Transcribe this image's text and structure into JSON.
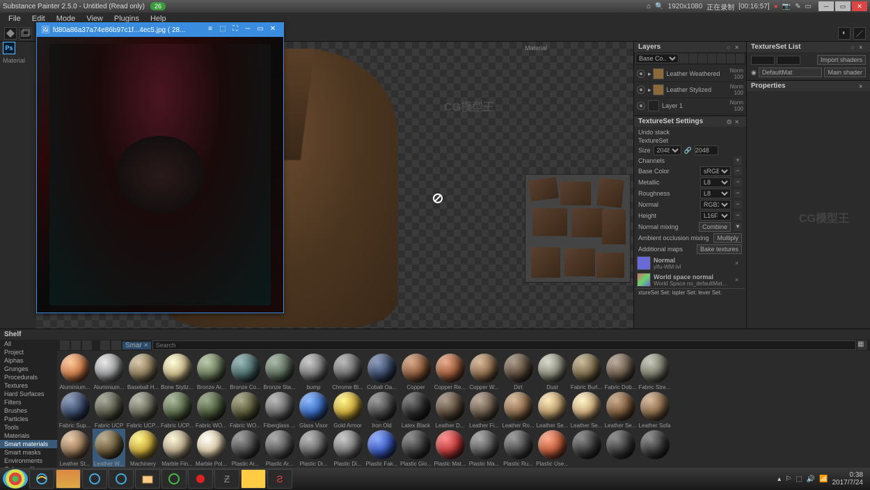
{
  "app": {
    "title": "Substance Painter 2.5.0 - Untitled (Read only)"
  },
  "recording": {
    "resolution": "1920x1080",
    "status": "正在录制",
    "time": "[00:16:57]"
  },
  "badge": "26",
  "menu": [
    "File",
    "Edit",
    "Mode",
    "View",
    "Plugins",
    "Help"
  ],
  "left_rail": {
    "label": "Material"
  },
  "imgwin": {
    "icon": "🖼",
    "title": "fd80a86a37a74e86b97c1f...4ec5.jpg ( 28..."
  },
  "viewport2d": {
    "label": "Material"
  },
  "panels": {
    "layers": {
      "title": "Layers",
      "channel": "Base Co..",
      "items": [
        {
          "name": "Leather Weathered",
          "mode": "Norm",
          "op": "100"
        },
        {
          "name": "Leather Stylized",
          "mode": "Norm",
          "op": "100"
        },
        {
          "name": "Layer 1",
          "mode": "Norm",
          "op": "100"
        }
      ]
    },
    "texset_list": {
      "title": "TextureSet List",
      "import": "Import shaders",
      "default": "DefaultMat",
      "main": "Main shader"
    },
    "properties": {
      "title": "Properties"
    },
    "texset": {
      "title": "TextureSet Settings",
      "undo": "Undo stack",
      "texset_label": "TextureSet",
      "size_label": "Size",
      "size": "2048",
      "size2": "2048",
      "channels": "Channels",
      "rows": [
        {
          "name": "Base Color",
          "fmt": "sRGB8"
        },
        {
          "name": "Metallic",
          "fmt": "L8"
        },
        {
          "name": "Roughness",
          "fmt": "L8"
        },
        {
          "name": "Normal",
          "fmt": "RGB16F"
        },
        {
          "name": "Height",
          "fmt": "L16F"
        }
      ],
      "normal_mixing": "Normal mixing",
      "combine": "Combine",
      "ao_mixing": "Ambient occlusion mixing",
      "multiply": "Multiply",
      "addmaps": "Additional maps",
      "bake": "Bake textures",
      "maps": [
        {
          "name": "Normal",
          "file": "yifu-WM-lvl"
        },
        {
          "name": "World space normal",
          "file": "World Space no_defaultMat..."
        }
      ],
      "bottom": "xtureSet Set:  ispler Set:  lever Set:"
    }
  },
  "shelf": {
    "title": "Shelf",
    "search_tag": "Smar",
    "search_placeholder": "Search",
    "cats": [
      "All",
      "Project",
      "Alphas",
      "Grunges",
      "Procedurals",
      "Textures",
      "Hard Surfaces",
      "Filters",
      "Brushes",
      "Particles",
      "Tools",
      "Materials",
      "Smart materials",
      "Smart masks",
      "Environments",
      "Color profiles"
    ],
    "cat_sel": 12,
    "materials_r1": [
      {
        "n": "Aluminium...",
        "c": "#c97a4a"
      },
      {
        "n": "Aluminium...",
        "c": "#9a9a9a"
      },
      {
        "n": "Baseball H...",
        "c": "#8a7a5a"
      },
      {
        "n": "Bone Styliz...",
        "c": "#c9b88a"
      },
      {
        "n": "Bronze Ar...",
        "c": "#6a7a5a"
      },
      {
        "n": "Bronze Co...",
        "c": "#4a6a6a"
      },
      {
        "n": "Bronze Sta...",
        "c": "#5a6a5a"
      },
      {
        "n": "bump",
        "c": "#7a7a7a"
      },
      {
        "n": "Chrome Bl...",
        "c": "#6a6a6a"
      },
      {
        "n": "Cobalt Oa...",
        "c": "#3a4a6a"
      },
      {
        "n": "Copper",
        "c": "#8a5a3a"
      },
      {
        "n": "Copper Re...",
        "c": "#9a5a3a"
      },
      {
        "n": "Copper W...",
        "c": "#8a6a4a"
      },
      {
        "n": "Dirt",
        "c": "#5a4a3a"
      },
      {
        "n": "Dust",
        "c": "#8a8a7a"
      },
      {
        "n": "Fabric Burl...",
        "c": "#7a6a4a"
      },
      {
        "n": "Fabric Dob...",
        "c": "#6a5a4a"
      },
      {
        "n": "Fabric Stre...",
        "c": "#7a7a6a"
      }
    ],
    "materials_r2": [
      {
        "n": "Fabric Sup...",
        "c": "#3a4a6a"
      },
      {
        "n": "Fabric UCP",
        "c": "#5a5a4a"
      },
      {
        "n": "Fabric UCP...",
        "c": "#6a6a5a"
      },
      {
        "n": "Fabric UCP...",
        "c": "#5a6a4a"
      },
      {
        "n": "Fabric WO...",
        "c": "#4a5a3a"
      },
      {
        "n": "Fabric WO...",
        "c": "#5a5a3a"
      },
      {
        "n": "Fiberglass ...",
        "c": "#6a6a6a"
      },
      {
        "n": "Glass Visor",
        "c": "#3a6abd"
      },
      {
        "n": "Gold Armor",
        "c": "#c9a83a"
      },
      {
        "n": "Iron Old",
        "c": "#4a4a4a"
      },
      {
        "n": "Latex Black",
        "c": "#2a2a2a"
      },
      {
        "n": "Leather D...",
        "c": "#5a4a3a"
      },
      {
        "n": "Leather Fi...",
        "c": "#6a5a4a"
      },
      {
        "n": "Leather Ro...",
        "c": "#8a6a4a"
      },
      {
        "n": "Leather Se...",
        "c": "#b89a6a"
      },
      {
        "n": "Leather Se...",
        "c": "#c9a87a"
      },
      {
        "n": "Leather Se...",
        "c": "#7a5a3a"
      },
      {
        "n": "Leather Sofa",
        "c": "#8a6a4a"
      }
    ],
    "materials_r3": [
      {
        "n": "Leather St...",
        "c": "#9a7a5a"
      },
      {
        "n": "Leather W...",
        "c": "#6a5a3a",
        "sel": true
      },
      {
        "n": "Machinery",
        "c": "#c9a83a"
      },
      {
        "n": "Marble Fin...",
        "c": "#b8a88a"
      },
      {
        "n": "Marble Pol...",
        "c": "#d8c8a8"
      },
      {
        "n": "Plastic Ar...",
        "c": "#4a4a4a"
      },
      {
        "n": "Plastic Ar...",
        "c": "#5a5a5a"
      },
      {
        "n": "Plastic Di...",
        "c": "#6a6a6a"
      },
      {
        "n": "Plastic Di...",
        "c": "#7a7a7a"
      },
      {
        "n": "Plastic Fak...",
        "c": "#3a5abd"
      },
      {
        "n": "Plastic Glo...",
        "c": "#3a3a3a"
      },
      {
        "n": "Plastic Mat...",
        "c": "#bd3a3a"
      },
      {
        "n": "Plastic Ma...",
        "c": "#5a5a5a"
      },
      {
        "n": "Plastic Ru...",
        "c": "#4a4a4a"
      },
      {
        "n": "Plastic Use...",
        "c": "#bd5a3a"
      },
      {
        "n": "",
        "c": "#3a3a3a"
      },
      {
        "n": "",
        "c": "#3a3a3a"
      },
      {
        "n": "",
        "c": "#3a3a3a"
      }
    ]
  },
  "taskbar": {
    "time": "0:38",
    "date": "2017/7/24"
  }
}
